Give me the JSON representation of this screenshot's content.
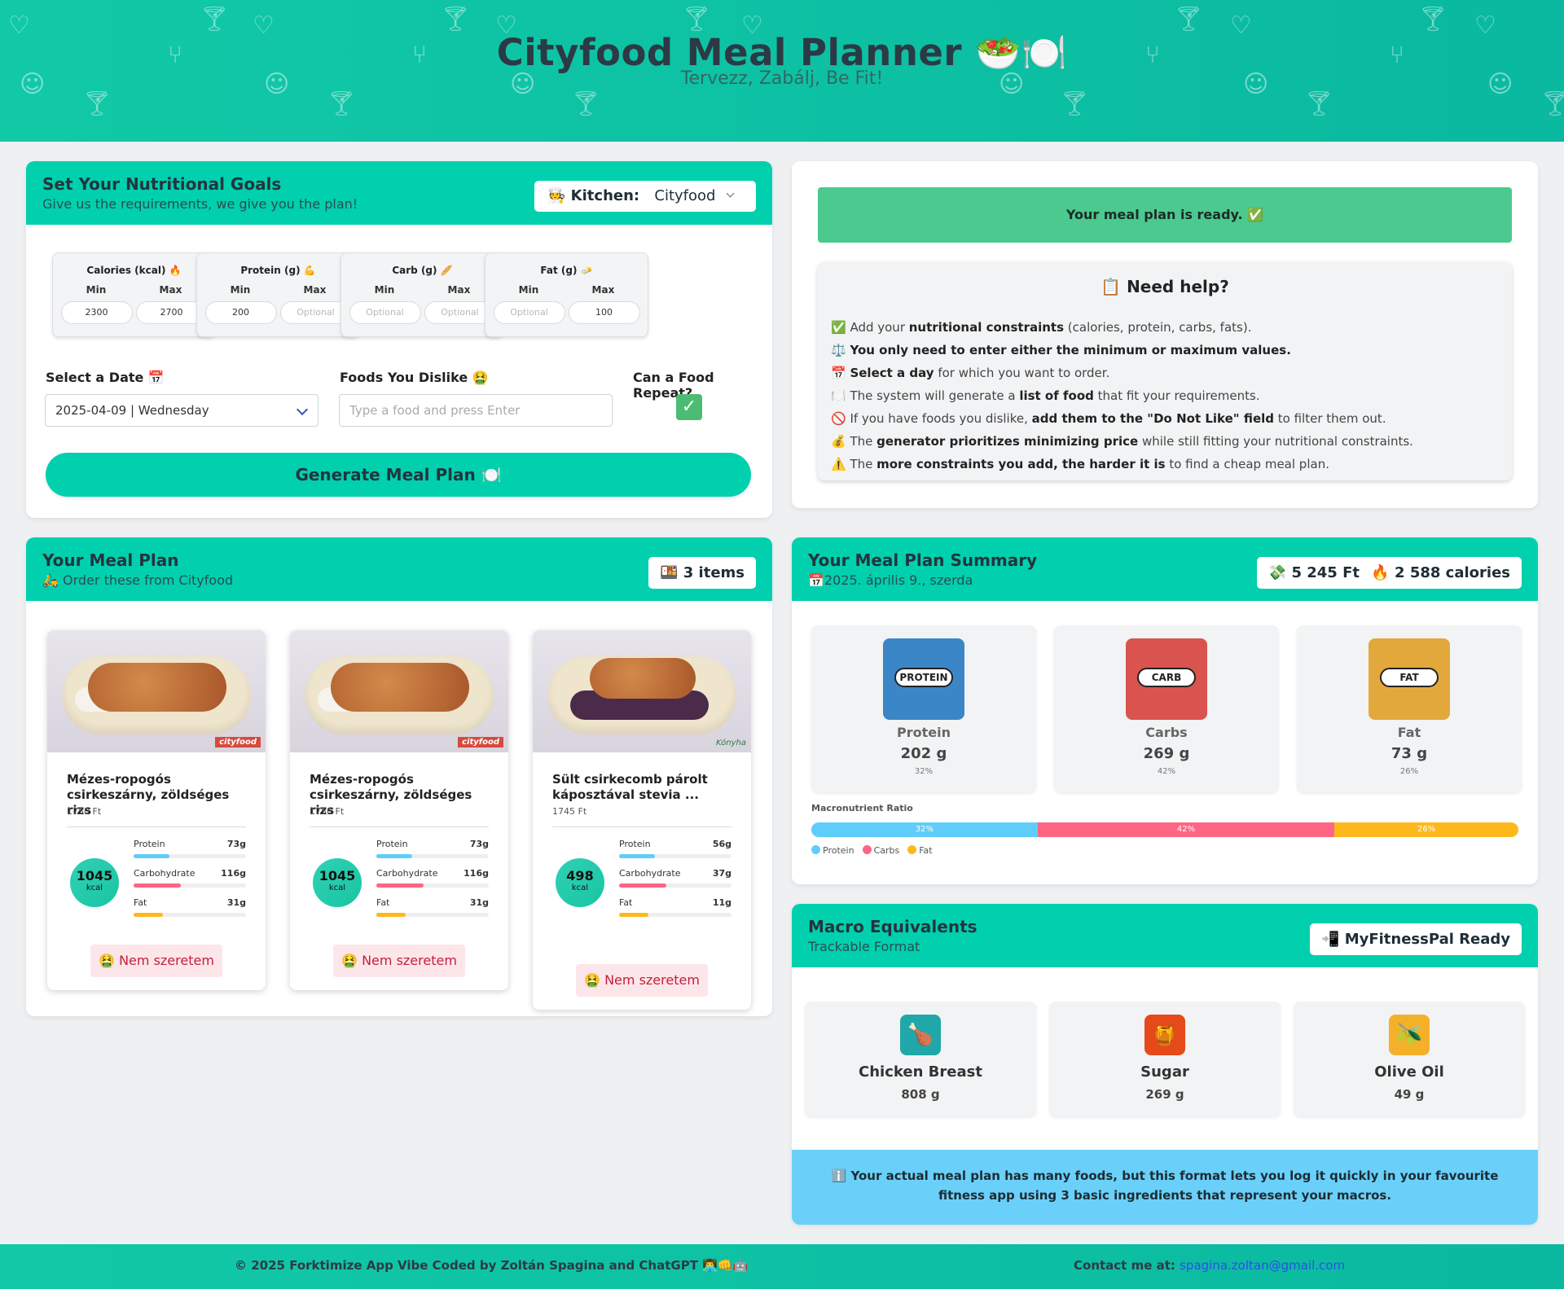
{
  "header": {
    "title": "Cityfood Meal Planner 🥗🍽️",
    "subtitle": "Tervezz, Zabálj, Be Fit!"
  },
  "goals": {
    "title": "Set Your Nutritional Goals",
    "subtitle": "Give us the requirements, we give you the plan!",
    "kitchen_label": "🧑‍🍳 Kitchen:",
    "kitchen_value": "Cityfood",
    "min_label": "Min",
    "max_label": "Max",
    "macros": [
      {
        "label": "Calories (kcal) 🔥",
        "min": "2300",
        "max": "2700",
        "min_ph": false,
        "max_ph": false
      },
      {
        "label": "Protein (g) 💪",
        "min": "200",
        "max": "Optional",
        "min_ph": false,
        "max_ph": true
      },
      {
        "label": "Carb (g) 🥖",
        "min": "Optional",
        "max": "Optional",
        "min_ph": true,
        "max_ph": true
      },
      {
        "label": "Fat (g) 🧈",
        "min": "Optional",
        "max": "100",
        "min_ph": true,
        "max_ph": false
      }
    ],
    "date_label": "Select a Date 📅",
    "date_value": "2025-04-09 | Wednesday",
    "dislike_label": "Foods You Dislike 🤮",
    "dislike_placeholder": "Type a food and press Enter",
    "repeat_label": "Can a Food Repeat?",
    "repeat_checked": true,
    "generate_label": "Generate Meal Plan 🍽️"
  },
  "status": {
    "ready": "Your meal plan is ready. ✅"
  },
  "help": {
    "title": "📋 Need help?"
  },
  "meal_plan": {
    "title": "Your Meal Plan",
    "subtitle": "🛵 Order these from Cityfood",
    "count": "🍱 3 items",
    "protein_label": "Protein",
    "carb_label": "Carbohydrate",
    "fat_label": "Fat",
    "kcal_unit": "kcal",
    "dislike_label": "🤮 Nem szeretem",
    "items": [
      {
        "name": "Mézes-ropogós csirkeszárny, zöldséges rizs",
        "price": "1750 Ft",
        "kcal": "1045",
        "protein": "73g",
        "carb": "116g",
        "fat": "31g",
        "protein_frac": 0.32,
        "carb_frac": 0.42,
        "fat_frac": 0.26,
        "brand": "cityfood"
      },
      {
        "name": "Mézes-ropogós csirkeszárny, zöldséges rizs",
        "price": "1750 Ft",
        "kcal": "1045",
        "protein": "73g",
        "carb": "116g",
        "fat": "31g",
        "protein_frac": 0.32,
        "carb_frac": 0.42,
        "fat_frac": 0.26,
        "brand": "cityfood"
      },
      {
        "name": "Sült csirkecomb párolt káposztával stevia ...",
        "price": "1745 Ft",
        "kcal": "498",
        "protein": "56g",
        "carb": "37g",
        "fat": "11g",
        "protein_frac": 0.32,
        "carb_frac": 0.42,
        "fat_frac": 0.26,
        "brand": "Kónyha"
      }
    ]
  },
  "summary": {
    "title": "Your Meal Plan Summary",
    "date": "📅2025. április 9., szerda",
    "price": "💸 5 245 Ft",
    "calories": "🔥 2 588 calories",
    "stats": [
      {
        "label": "Protein",
        "value": "202 g",
        "pct": "32%",
        "icon": "PROTEIN",
        "color": "#3b86c6"
      },
      {
        "label": "Carbs",
        "value": "269 g",
        "pct": "42%",
        "icon": "CARB",
        "color": "#d9534f"
      },
      {
        "label": "Fat",
        "value": "73 g",
        "pct": "26%",
        "icon": "FAT",
        "color": "#e3a83c"
      }
    ],
    "ratio_label": "Macronutrient Ratio",
    "ratio": [
      {
        "name": "Protein",
        "pct": 32,
        "label": "32%",
        "color": "#5fcdfa"
      },
      {
        "name": "Carbs",
        "pct": 42,
        "label": "42%",
        "color": "#ff6584"
      },
      {
        "name": "Fat",
        "pct": 26,
        "label": "26%",
        "color": "#ffb81c"
      }
    ]
  },
  "equivalents": {
    "title": "Macro Equivalents",
    "subtitle": "Trackable Format",
    "badge": "📲 MyFitnessPal Ready",
    "items": [
      {
        "name": "Chicken Breast",
        "value": "808 g",
        "icon": "chicken-breast-icon",
        "glyph": "🍗",
        "color": "#1fa7a9"
      },
      {
        "name": "Sugar",
        "value": "269 g",
        "icon": "sugar-icon",
        "glyph": "🍯",
        "color": "#e64a19"
      },
      {
        "name": "Olive Oil",
        "value": "49 g",
        "icon": "olive-oil-icon",
        "glyph": "🫒",
        "color": "#f5b02a"
      }
    ],
    "info": "ℹ️ Your actual meal plan has many foods, but this format lets you log it quickly in your favourite fitness app using 3 basic ingredients that represent your macros."
  },
  "footer": {
    "copyright": "© 2025 Forktimize App Vibe Coded by Zoltán Spagina and ChatGPT 👨‍💻👊🤖",
    "contact_label": "Contact me at: ",
    "email": "spagina.zoltan@gmail.com"
  }
}
